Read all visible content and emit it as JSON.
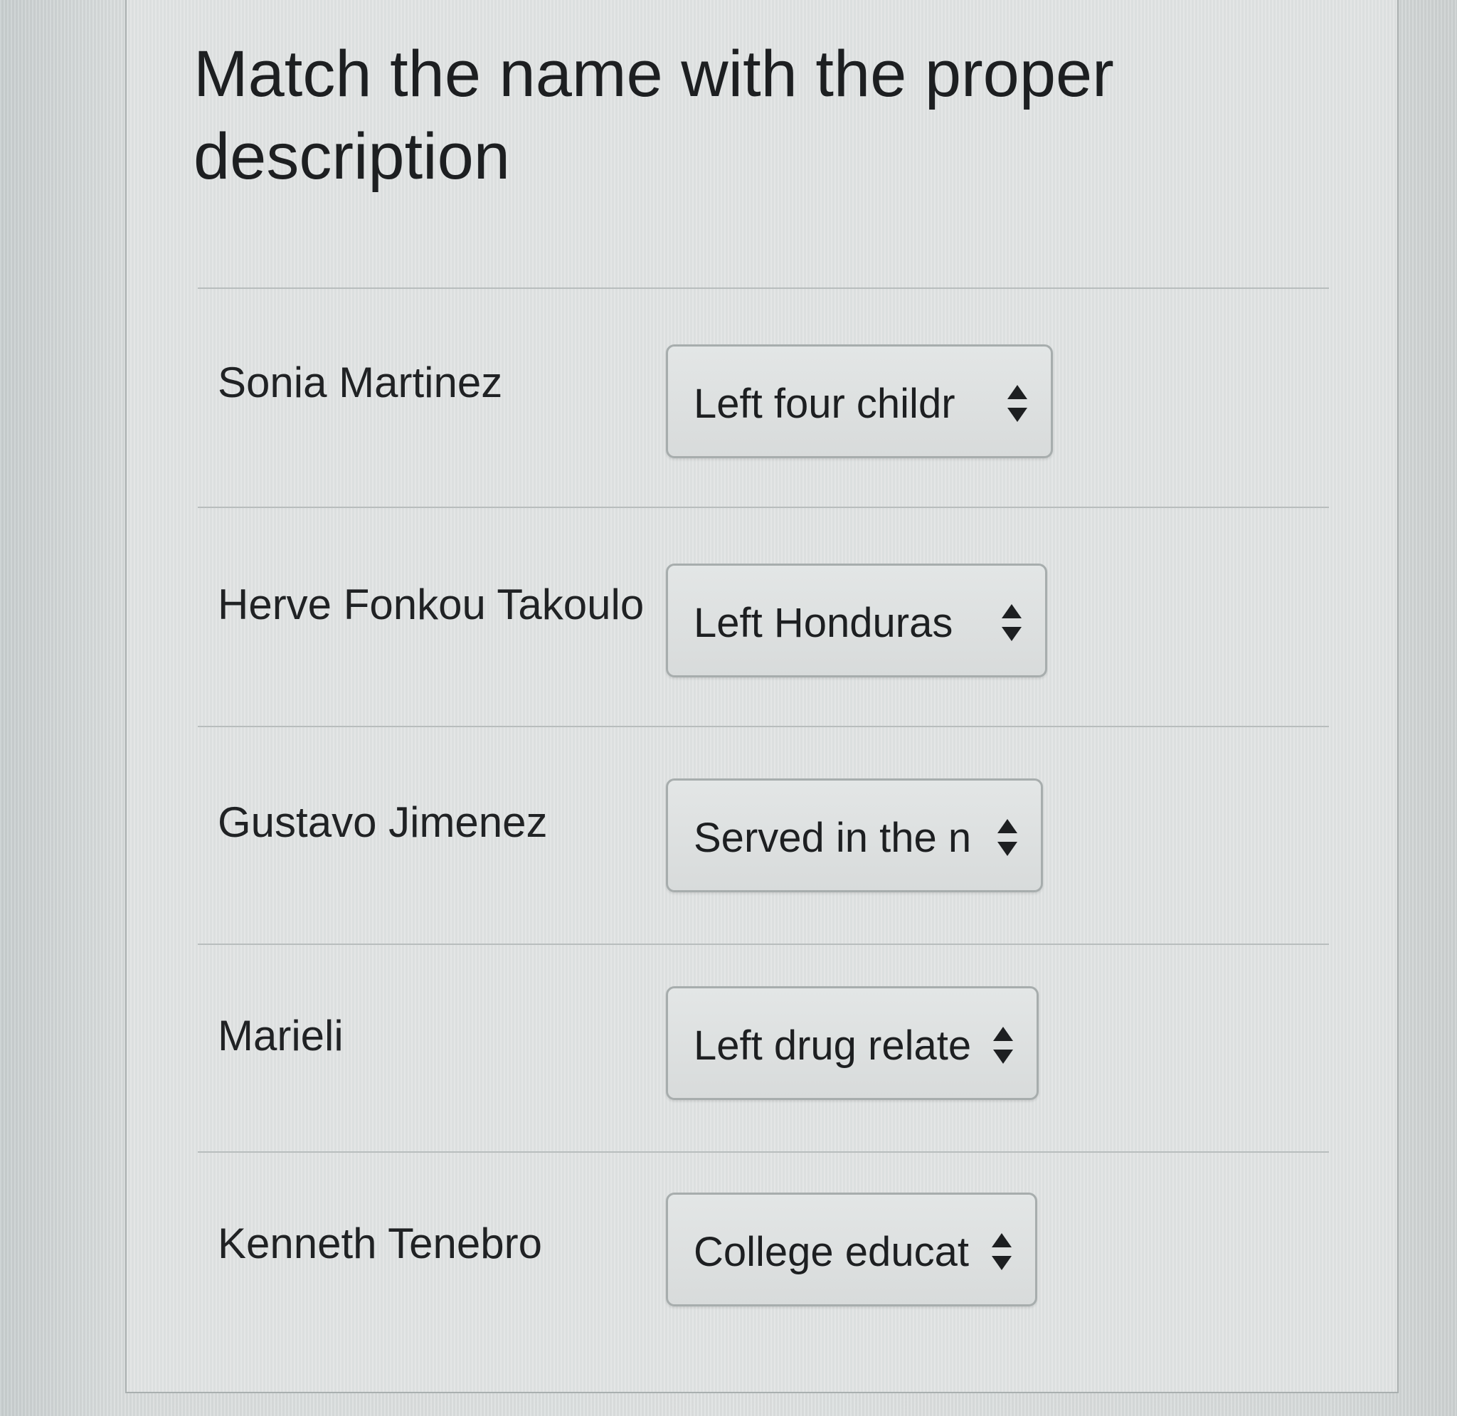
{
  "question": {
    "title": "Match the name with the proper description"
  },
  "rows": [
    {
      "name": "Sonia Martinez",
      "selected": "Left four childr"
    },
    {
      "name": "Herve Fonkou Takoulo",
      "selected": "Left Honduras"
    },
    {
      "name": "Gustavo Jimenez",
      "selected": "Served in the n"
    },
    {
      "name": "Marieli",
      "selected": "Left drug relate"
    },
    {
      "name": "Kenneth Tenebro",
      "selected": "College educat"
    }
  ],
  "icons": {
    "select_arrows": "up-down-caret-icon"
  },
  "colors": {
    "text": "#1d1f21",
    "select_border": "#a7adad",
    "select_background": "#dcdfdf",
    "divider": "#b8bdbd"
  }
}
